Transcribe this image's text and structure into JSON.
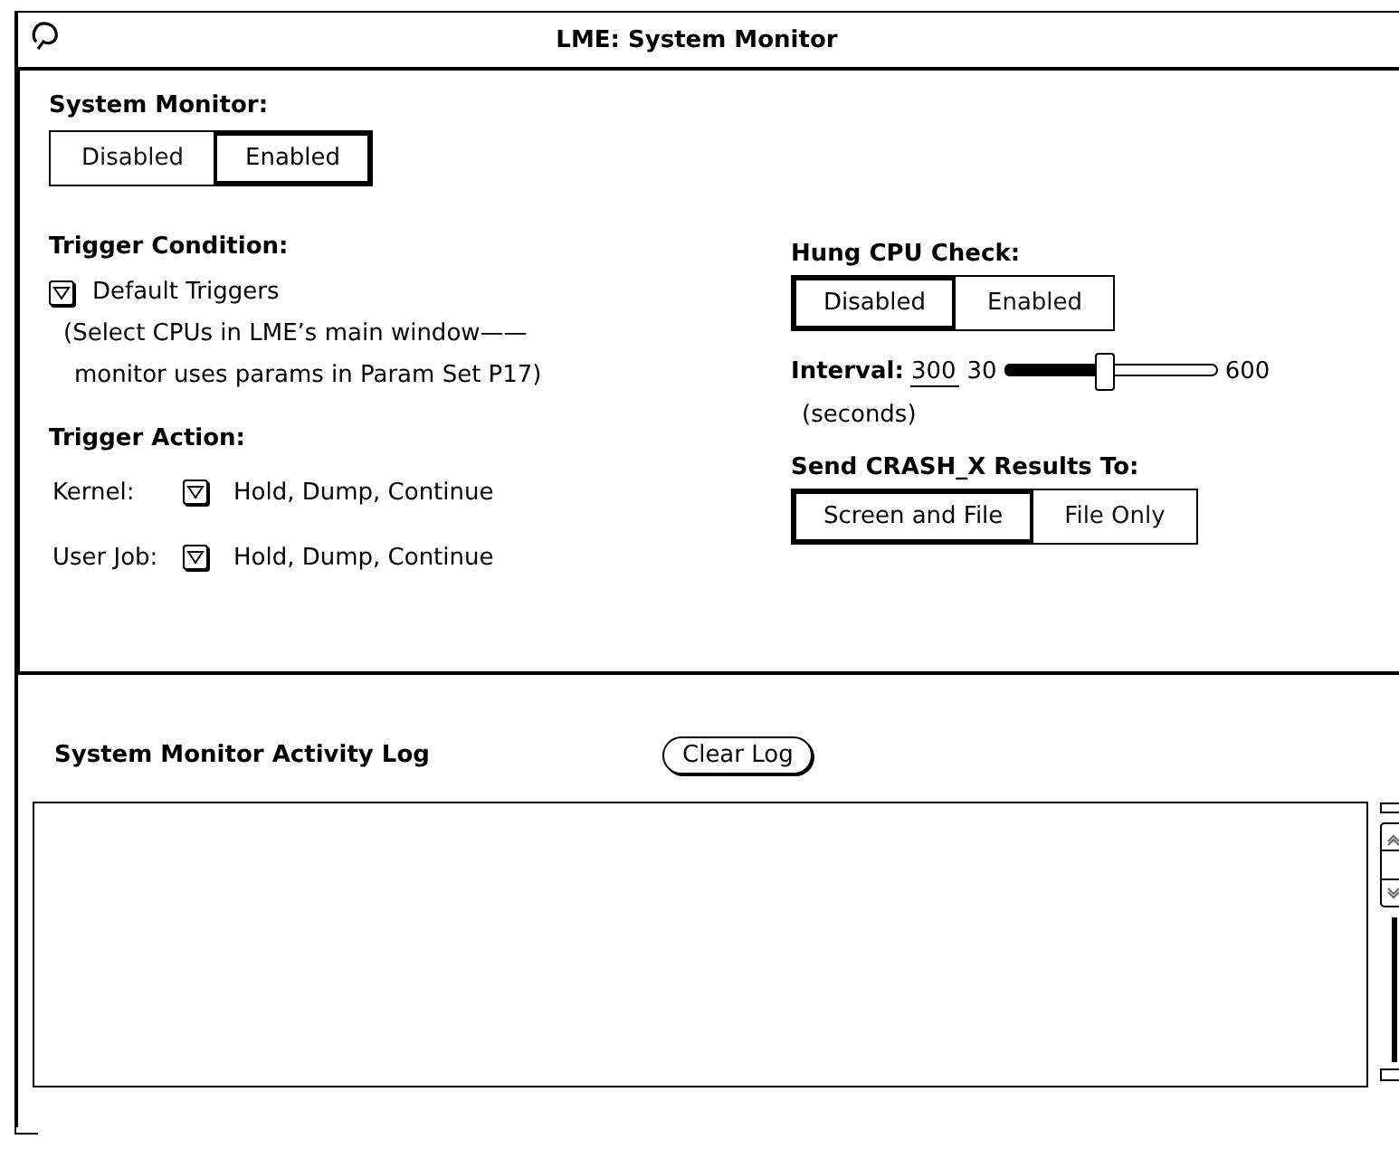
{
  "window": {
    "title": "LME: System Monitor"
  },
  "system_monitor": {
    "label": "System Monitor:",
    "options": [
      {
        "label": "Disabled",
        "selected": false
      },
      {
        "label": "Enabled",
        "selected": true
      }
    ]
  },
  "trigger_condition": {
    "label": "Trigger Condition:",
    "menu_value": "Default Triggers",
    "note_lines": [
      "(Select CPUs in LME’s main window——",
      "monitor uses params in Param Set P17)"
    ]
  },
  "trigger_action": {
    "label": "Trigger Action:",
    "rows": [
      {
        "label": "Kernel:",
        "value": "Hold, Dump, Continue"
      },
      {
        "label": "User Job:",
        "value": "Hold, Dump, Continue"
      }
    ]
  },
  "hung_cpu_check": {
    "label": "Hung CPU Check:",
    "options": [
      {
        "label": "Disabled",
        "selected": true
      },
      {
        "label": "Enabled",
        "selected": false
      }
    ]
  },
  "interval": {
    "label": "Interval:",
    "value": "300",
    "min": "30",
    "max": "600",
    "level": 0.47,
    "units": "(seconds)"
  },
  "send_results": {
    "label": "Send CRASH_X Results To:",
    "options": [
      {
        "label": "Screen and File",
        "selected": true
      },
      {
        "label": "File Only",
        "selected": false
      }
    ]
  },
  "activity_log": {
    "label": "System Monitor Activity Log",
    "button": "Clear Log"
  }
}
